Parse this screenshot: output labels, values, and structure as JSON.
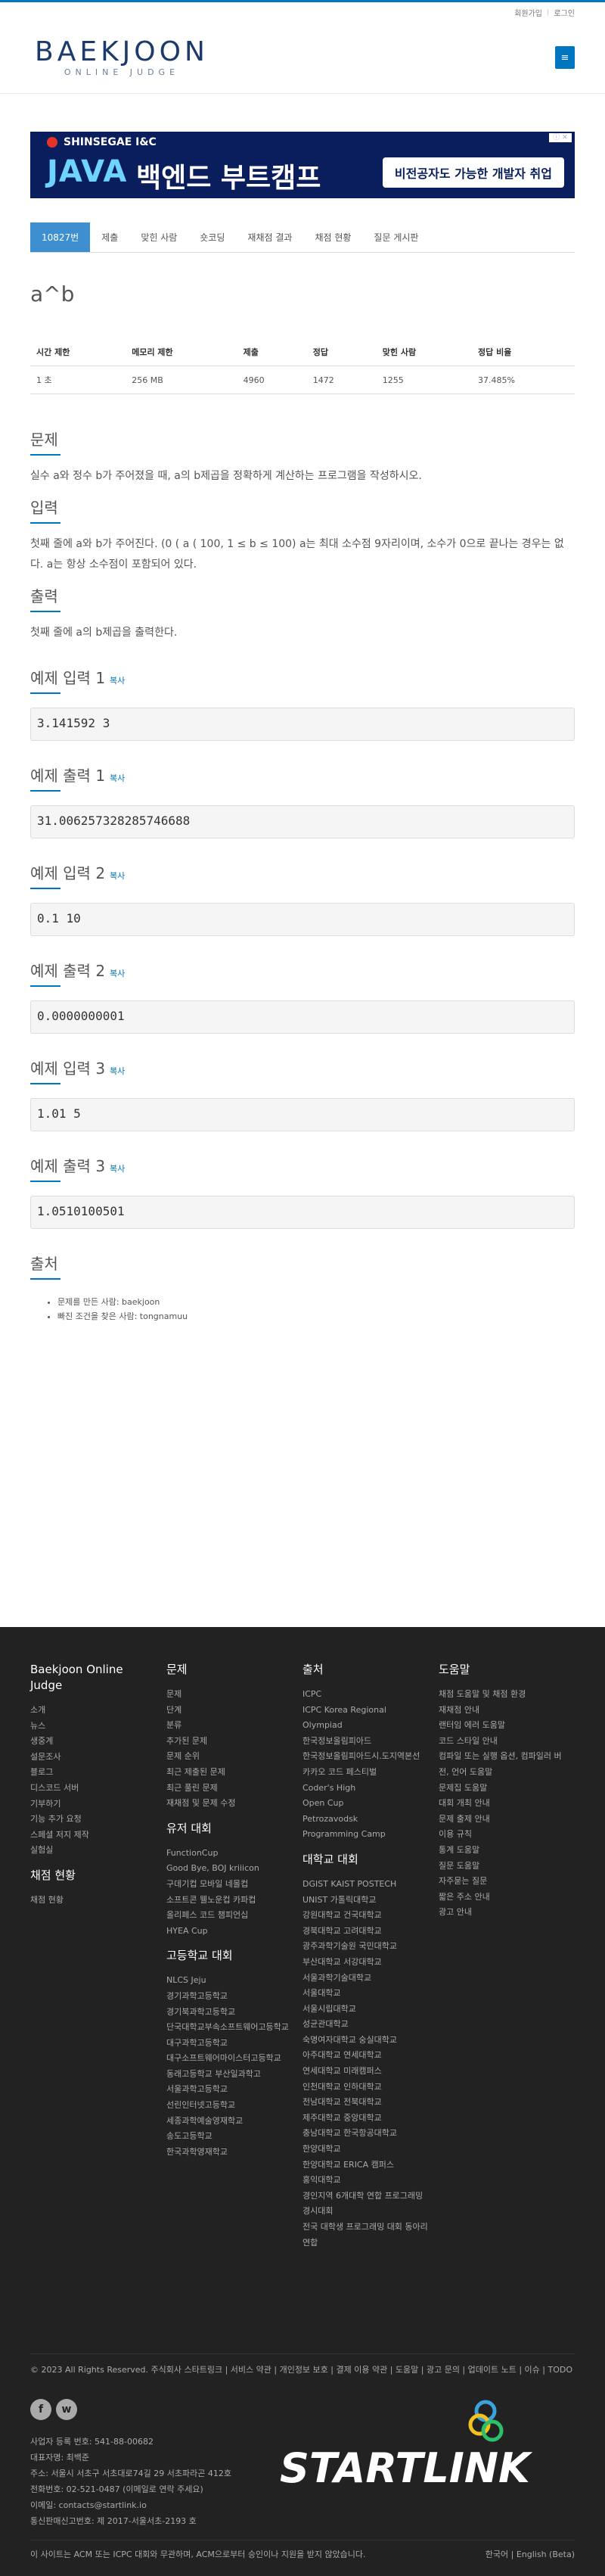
{
  "topbar": {
    "signup": "회원가입",
    "login": "로그인"
  },
  "logo": {
    "main": "BAEKJOON",
    "sub": "ONLINE JUDGE"
  },
  "menu_icon": "hamburger-icon",
  "ad": {
    "brand": "SHINSEGAE I&C",
    "java": "JAVA",
    "headline": "백엔드 부트캠프",
    "pill": "비전공자도 가능한 개발자 취업"
  },
  "tabs": [
    "10827번",
    "제출",
    "맞힌 사람",
    "숏코딩",
    "재채점 결과",
    "채점 현황",
    "질문 게시판"
  ],
  "problem": {
    "title": "a^b",
    "info_headers": [
      "시간 제한",
      "메모리 제한",
      "제출",
      "정답",
      "맞힌 사람",
      "정답 비율"
    ],
    "info_values": [
      "1 초",
      "256 MB",
      "4960",
      "1472",
      "1255",
      "37.485%"
    ],
    "description_title": "문제",
    "description": "실수 a와 정수 b가 주어졌을 때, a의 b제곱을 정확하게 계산하는 프로그램을 작성하시오.",
    "input_title": "입력",
    "input": "첫째 줄에 a와 b가 주어진다. (0 ( a ( 100, 1 ≤ b ≤ 100) a는 최대 소수점 9자리이며, 소수가 0으로 끝나는 경우는 없다. a는 항상 소수점이 포함되어 있다.",
    "output_title": "출력",
    "output": "첫째 줄에 a의 b제곱을 출력한다.",
    "copy_label": "복사",
    "samples": [
      {
        "in_title": "예제 입력 1",
        "in": "3.141592 3",
        "out_title": "예제 출력 1",
        "out": "31.006257328285746688"
      },
      {
        "in_title": "예제 입력 2",
        "in": "0.1 10",
        "out_title": "예제 출력 2",
        "out": "0.0000000001"
      },
      {
        "in_title": "예제 입력 3",
        "in": "1.01 5",
        "out_title": "예제 출력 3",
        "out": "1.0510100501"
      }
    ],
    "source_title": "출처",
    "source": [
      "문제를 만든 사람: baekjoon",
      "빠진 조건을 찾은 사람: tongnamuu"
    ]
  },
  "footer": {
    "col1": {
      "title": "Baekjoon Online Judge",
      "links": [
        "소개",
        "뉴스",
        "생중계",
        "설문조사",
        "블로그",
        "디스코드 서버",
        "기부하기",
        "기능 추가 요청",
        "스페셜 저지 제작",
        "실험실"
      ],
      "sub_title": "채점 현황",
      "sub_links": [
        "채점 현황"
      ]
    },
    "col2": {
      "title": "문제",
      "links": [
        "문제",
        "단계",
        "분류",
        "추가된 문제",
        "문제 순위",
        "최근 제출된 문제",
        "최근 풀린 문제",
        "재채점 및 문제 수정"
      ],
      "sub_title": "유저 대회",
      "sub_links": [
        "FunctionCup",
        "Good Bye, BOJ kriiicon",
        "구데기컵 모바일 네몰컵",
        "소프트콘 웰노운컵 카파컵",
        "올리페스 코드 챔피언십",
        "HYEA Cup"
      ],
      "sub2_title": "고등학교 대회",
      "sub2_links": [
        "NLCS Jeju",
        "경기과학고등학교",
        "경기북과학고등학교",
        "단국대학교부속소프트웨어고등학교",
        "대구과학고등학교",
        "대구소프트웨어마이스터고등학교",
        "동래고등학교 부산일과학고",
        "서울과학고등학교",
        "선린인터넷고등학교",
        "세종과학예술영재학교",
        "송도고등학교",
        "한국과학영재학교"
      ]
    },
    "col3": {
      "title": "출처",
      "links": [
        "ICPC",
        "ICPC Korea Regional",
        "Olympiad",
        "한국정보올림피아드",
        "한국정보올림피아드시.도지역본선",
        "카카오 코드 페스티벌",
        "Coder's High",
        "Open Cup",
        "Petrozavodsk",
        "Programming Camp"
      ],
      "sub_title": "대학교 대회",
      "sub_links": [
        "DGIST KAIST POSTECH",
        "UNIST 가톨릭대학교",
        "강원대학교 건국대학교",
        "경북대학교 고려대학교",
        "광주과학기술원 국민대학교",
        "부산대학교 서강대학교",
        "서울과학기술대학교",
        "서울대학교",
        "서울시립대학교",
        "성균관대학교",
        "숙명여자대학교 숭실대학교",
        "아주대학교 연세대학교",
        "연세대학교 미래캠퍼스",
        "인천대학교 인하대학교",
        "전남대학교 전북대학교",
        "제주대학교 중앙대학교",
        "충남대학교 한국항공대학교",
        "한양대학교",
        "한양대학교 ERICA 캠퍼스",
        "홍익대학교",
        "경인지역 6개대학 연합 프로그래밍 경시대회",
        "전국 대학생 프로그래밍 대회 동아리 연합"
      ]
    },
    "col4": {
      "title": "도움말",
      "links": [
        "채점 도움말 및 채점 환경",
        "재채점 안내",
        "랜터임 에러 도움말",
        "코드 스타일 안내",
        "컴파일 또는 실행 옵션, 컴파일러 버전, 언어 도움말",
        "문제집 도움말",
        "대회 개최 안내",
        "문제 출제 안내",
        "이용 규칙",
        "통계 도움말",
        "질문 도움말",
        "자주묻는 질문",
        "짧은 주소 안내",
        "광고 안내"
      ]
    },
    "copyright": "© 2023 All Rights Reserved. 주식회사 스타트링크 | 서비스 약관 | 개인정보 보호 | 결제 이용 약관 | 도움말 | 광고 문의 | 업데이트 노트 | 이슈 | TODO",
    "social": [
      "f",
      "w"
    ],
    "business": [
      "사업자 등록 번호: 541-88-00682",
      "대표자명: 최백준",
      "주소: 서울시 서초구 서초대로74길 29 서초파라곤 412호",
      "전화번호: 02-521-0487 (이메일로 연락 주세요)",
      "이메일: contacts@startlink.io",
      "통신판매신고번호: 제 2017-서울서초-2193 호"
    ],
    "startlink": "STARTLINK",
    "disclaimer": "이 사이트는 ACM 또는 ICPC 대회와 무관하며, ACM으로부터 승인이나 지원을 받지 않았습니다.",
    "languages": "한국어 | English (Beta)"
  }
}
